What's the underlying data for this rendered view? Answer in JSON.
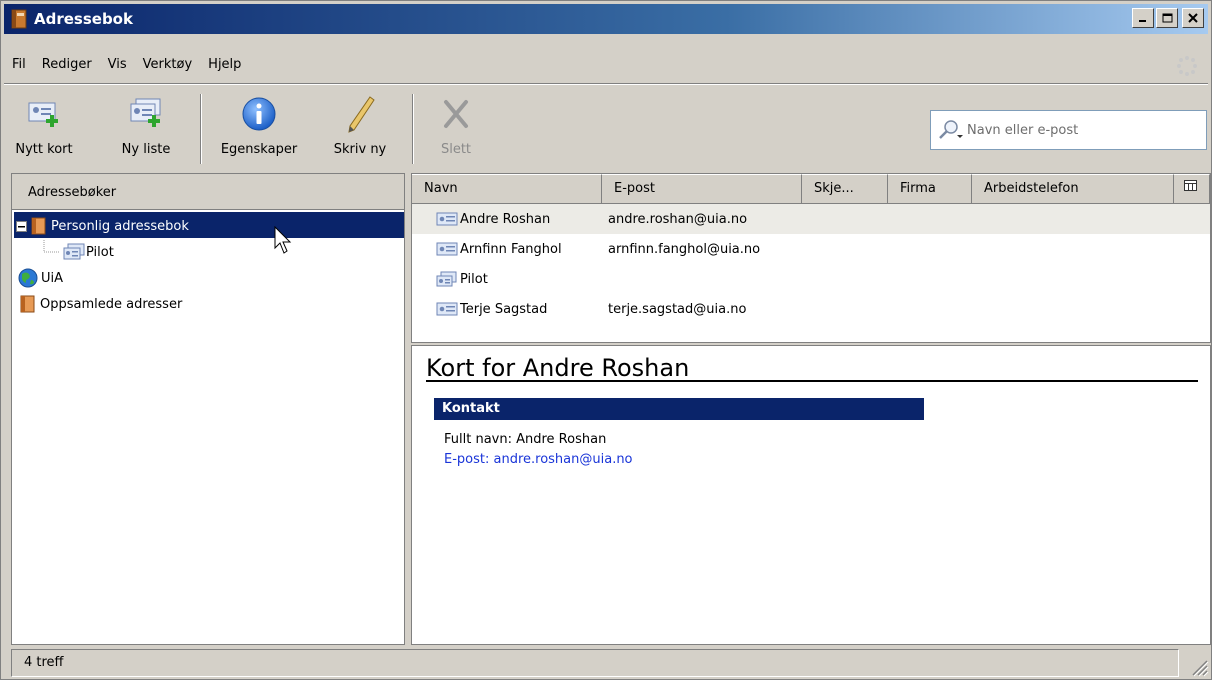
{
  "window": {
    "title": "Adressebok"
  },
  "menu": [
    {
      "label": "Fil"
    },
    {
      "label": "Rediger"
    },
    {
      "label": "Vis"
    },
    {
      "label": "Verktøy"
    },
    {
      "label": "Hjelp"
    }
  ],
  "toolbar": {
    "new_card": "Nytt kort",
    "new_list": "Ny liste",
    "properties": "Egenskaper",
    "write": "Skriv ny",
    "delete": "Slett"
  },
  "search": {
    "placeholder": "Navn eller e-post"
  },
  "left": {
    "header": "Adressebøker",
    "items": [
      {
        "label": "Personlig adressebok",
        "icon": "address-book-icon",
        "selected": true
      },
      {
        "label": "Pilot",
        "icon": "mailing-list-icon"
      },
      {
        "label": "UiA",
        "icon": "globe-icon"
      },
      {
        "label": "Oppsamlede adresser",
        "icon": "address-book-icon"
      }
    ]
  },
  "list": {
    "columns": [
      "Navn",
      "E-post",
      "Skje...",
      "Firma",
      "Arbeidstelefon"
    ],
    "rows": [
      {
        "name": "Andre Roshan",
        "email": "andre.roshan@uia.no",
        "icon": "contact-card-icon"
      },
      {
        "name": "Arnfinn Fanghol",
        "email": "arnfinn.fanghol@uia.no",
        "icon": "contact-card-icon"
      },
      {
        "name": "Pilot",
        "email": "",
        "icon": "mailing-list-icon"
      },
      {
        "name": "Terje Sagstad",
        "email": "terje.sagstad@uia.no",
        "icon": "contact-card-icon"
      }
    ]
  },
  "card": {
    "title": "Kort for Andre Roshan",
    "section": "Kontakt",
    "full_name": "Fullt navn: Andre Roshan",
    "email": "E-post: andre.roshan@uia.no"
  },
  "status": {
    "text": "4 treff"
  },
  "colors": {
    "selection": "#0a246a",
    "link": "#1a35d8",
    "chrome": "#d4d0c8"
  }
}
